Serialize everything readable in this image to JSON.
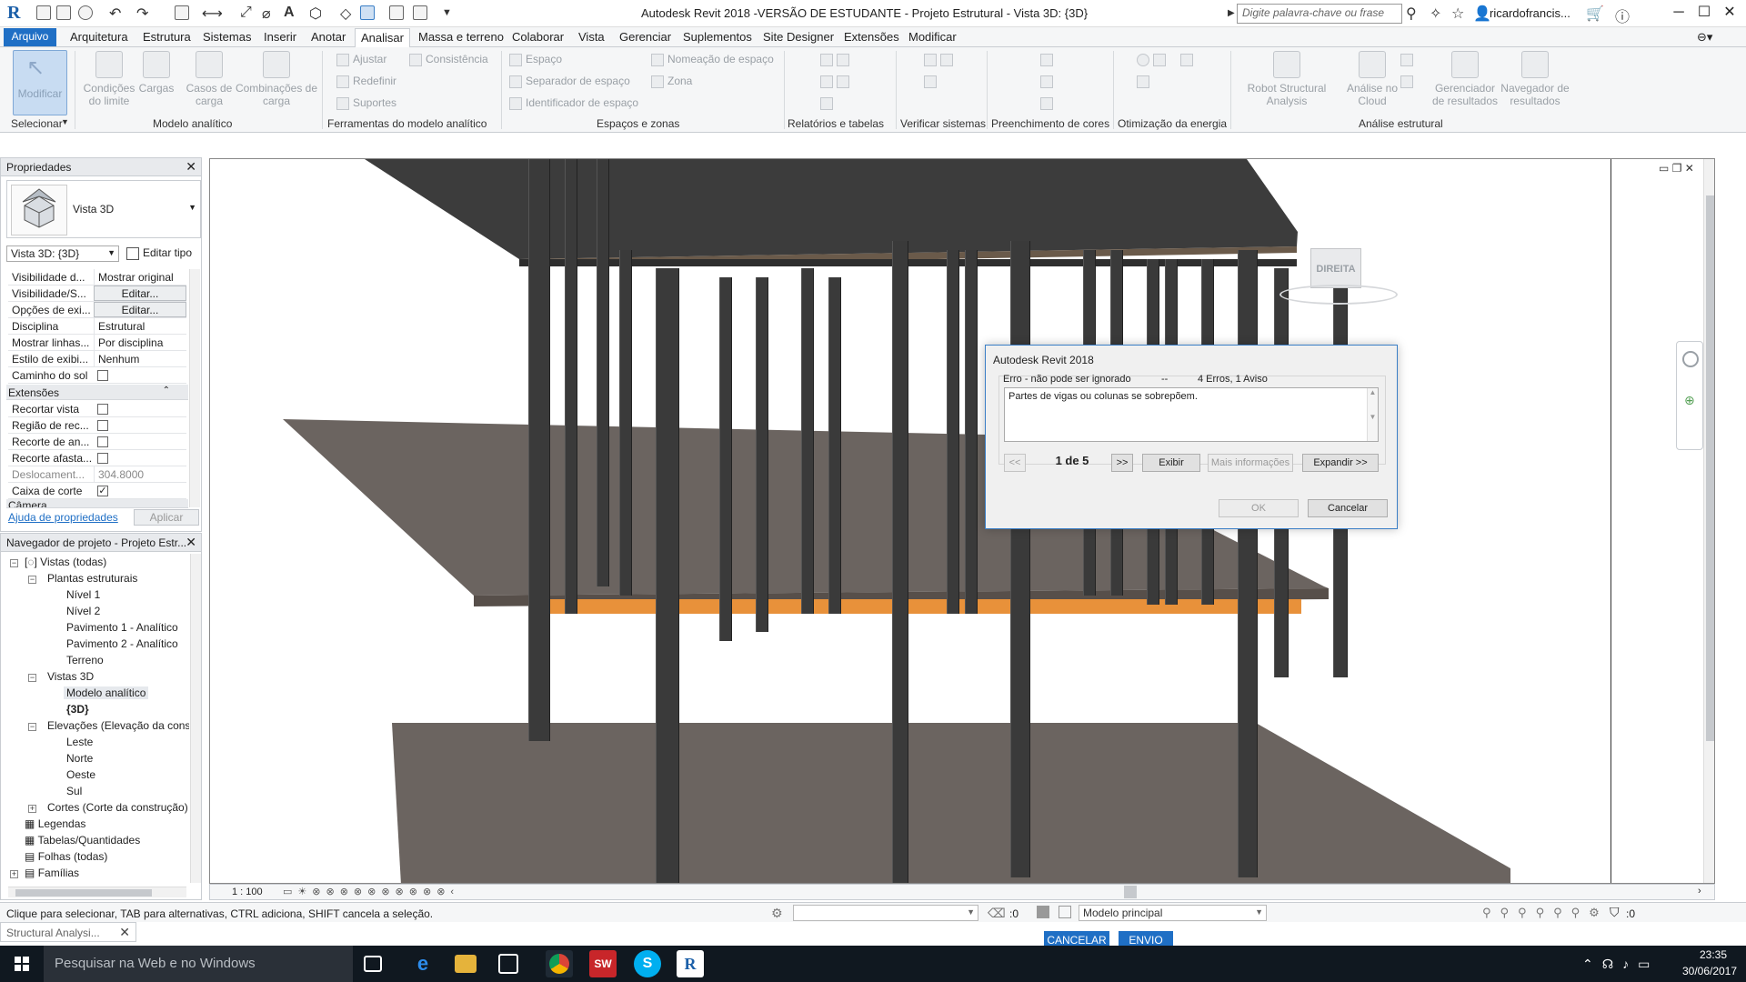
{
  "window": {
    "title": "Autodesk Revit 2018 -VERSÃO DE ESTUDANTE -   Projeto Estrutural - Vista 3D: {3D}",
    "search_placeholder": "Digite palavra-chave ou frase",
    "user": "ricardofrancis...",
    "accent": "#1f6fc5"
  },
  "tabs": [
    "Arquitetura",
    "Estrutura",
    "Sistemas",
    "Inserir",
    "Anotar",
    "Analisar",
    "Massa e terreno",
    "Colaborar",
    "Vista",
    "Gerenciar",
    "Suplementos",
    "Site Designer",
    "Extensões",
    "Modificar"
  ],
  "tab_file": "Arquivo",
  "active_tab": "Analisar",
  "ribbon": {
    "modificar": "Modificar",
    "selecionar": "Selecionar",
    "condicoes": "Condições do limite",
    "cargas": "Cargas",
    "casos": "Casos de carga",
    "combinacoes": "Combinações de carga",
    "modelo_analitico": "Modelo analítico",
    "ajustar": "Ajustar",
    "consistencia": "Consistência",
    "redefinir": "Redefinir",
    "suportes": "Suportes",
    "ferramentas": "Ferramentas do modelo analítico",
    "espaco": "Espaço",
    "separador": "Separador de espaço",
    "identificador": "Identificador de espaço",
    "nomeacao": "Nomeação de espaço",
    "zona": "Zona",
    "espacos_zonas": "Espaços e zonas",
    "relatorios": "Relatórios e tabelas",
    "verificar": "Verificar sistemas",
    "preenchimento": "Preenchimento de cores",
    "otimizacao": "Otimização da energia",
    "robot": "Robot Structural Analysis",
    "analise_cloud": "Análise no Cloud",
    "gerenciador": "Gerenciador de resultados",
    "navegador": "Navegador de resultados",
    "analise_estrutural": "Análise estrutural"
  },
  "properties": {
    "title": "Propriedades",
    "type": "Vista 3D",
    "view_selector": "Vista 3D: {3D}",
    "edit_type": "Editar tipo",
    "rows": [
      {
        "k": "Visibilidade d...",
        "v": "Mostrar original"
      },
      {
        "k": "Visibilidade/S...",
        "v": "Editar..."
      },
      {
        "k": "Opções de exi...",
        "v": "Editar..."
      },
      {
        "k": "Disciplina",
        "v": "Estrutural"
      },
      {
        "k": "Mostrar linhas...",
        "v": "Por disciplina"
      },
      {
        "k": "Estilo de exibi...",
        "v": "Nenhum"
      },
      {
        "k": "Caminho do sol",
        "v": ""
      }
    ],
    "cat_extensoes": "Extensões",
    "ext_rows": [
      {
        "k": "Recortar vista",
        "checked": false
      },
      {
        "k": "Região de rec...",
        "checked": false
      },
      {
        "k": "Recorte de an...",
        "checked": false
      },
      {
        "k": "Recorte afasta...",
        "checked": false
      },
      {
        "k": "Deslocament...",
        "v": "304.8000"
      },
      {
        "k": "Caixa de corte",
        "checked": true
      }
    ],
    "cat_camera": "Câmera",
    "help": "Ajuda de propriedades",
    "apply": "Aplicar"
  },
  "browser": {
    "title": "Navegador de projeto - Projeto Estr...",
    "vistas": "Vistas (todas)",
    "plantas": "Plantas estruturais",
    "nivel1": "Nível 1",
    "nivel2": "Nível 2",
    "pav1": "Pavimento 1 - Analítico",
    "pav2": "Pavimento 2 - Analítico",
    "terreno": "Terreno",
    "vistas3d": "Vistas 3D",
    "modelo": "Modelo analítico",
    "v3d": "{3D}",
    "elevacoes": "Elevações (Elevação da constr",
    "leste": "Leste",
    "norte": "Norte",
    "oeste": "Oeste",
    "sul": "Sul",
    "cortes": "Cortes (Corte da construção)",
    "legendas": "Legendas",
    "tabelas": "Tabelas/Quantidades",
    "folhas": "Folhas (todas)",
    "familias": "Famílias"
  },
  "viewcube": {
    "face": "DIREITA"
  },
  "dialog": {
    "title": "Autodesk Revit 2018",
    "type": "Erro - não pode ser ignorado",
    "sep": "--",
    "count": "4 Erros, 1 Aviso",
    "message": "Partes de vigas ou colunas se sobrepõem.",
    "prev": "<<",
    "page": "1 de 5",
    "next": ">>",
    "show": "Exibir",
    "more": "Mais informações",
    "expand": "Expandir >>",
    "ok": "OK",
    "cancel": "Cancelar"
  },
  "view_bar": {
    "scale": "1 : 100"
  },
  "status": {
    "text": "Clique para selecionar, TAB para alternativas, CTRL adiciona, SHIFT cancela a seleção.",
    "sel": ":0",
    "model": "Modelo principal",
    "filter": ":0"
  },
  "structural_tab": "Structural Analysi...",
  "analysis_buttons": {
    "cancel": "CANCELAR",
    "send": "ENVIO"
  },
  "taskbar": {
    "search": "Pesquisar na Web e no Windows",
    "time": "23:35",
    "date": "30/06/2017",
    "app_sw": "SW",
    "app_revit": "R"
  }
}
